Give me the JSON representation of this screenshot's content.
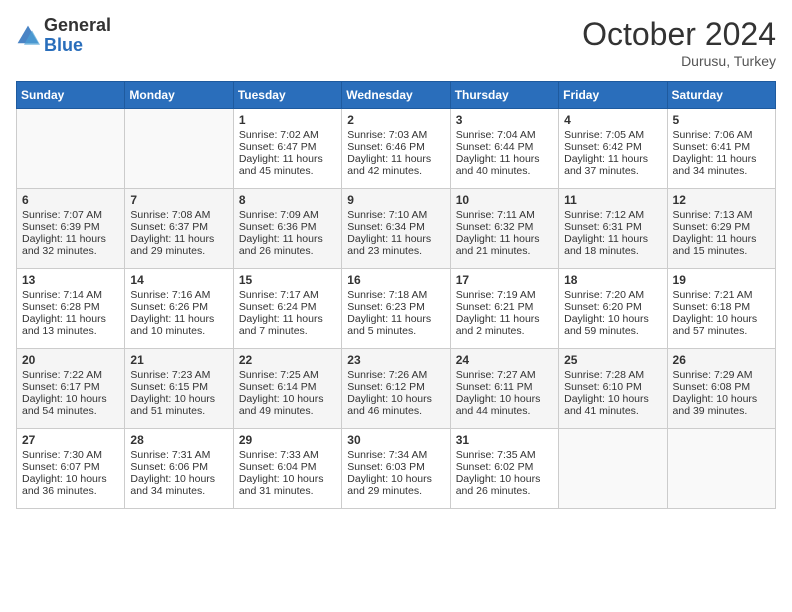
{
  "header": {
    "logo_general": "General",
    "logo_blue": "Blue",
    "month_title": "October 2024",
    "location": "Durusu, Turkey"
  },
  "days_of_week": [
    "Sunday",
    "Monday",
    "Tuesday",
    "Wednesday",
    "Thursday",
    "Friday",
    "Saturday"
  ],
  "weeks": [
    [
      {
        "day": "",
        "sunrise": "",
        "sunset": "",
        "daylight": ""
      },
      {
        "day": "",
        "sunrise": "",
        "sunset": "",
        "daylight": ""
      },
      {
        "day": "1",
        "sunrise": "Sunrise: 7:02 AM",
        "sunset": "Sunset: 6:47 PM",
        "daylight": "Daylight: 11 hours and 45 minutes."
      },
      {
        "day": "2",
        "sunrise": "Sunrise: 7:03 AM",
        "sunset": "Sunset: 6:46 PM",
        "daylight": "Daylight: 11 hours and 42 minutes."
      },
      {
        "day": "3",
        "sunrise": "Sunrise: 7:04 AM",
        "sunset": "Sunset: 6:44 PM",
        "daylight": "Daylight: 11 hours and 40 minutes."
      },
      {
        "day": "4",
        "sunrise": "Sunrise: 7:05 AM",
        "sunset": "Sunset: 6:42 PM",
        "daylight": "Daylight: 11 hours and 37 minutes."
      },
      {
        "day": "5",
        "sunrise": "Sunrise: 7:06 AM",
        "sunset": "Sunset: 6:41 PM",
        "daylight": "Daylight: 11 hours and 34 minutes."
      }
    ],
    [
      {
        "day": "6",
        "sunrise": "Sunrise: 7:07 AM",
        "sunset": "Sunset: 6:39 PM",
        "daylight": "Daylight: 11 hours and 32 minutes."
      },
      {
        "day": "7",
        "sunrise": "Sunrise: 7:08 AM",
        "sunset": "Sunset: 6:37 PM",
        "daylight": "Daylight: 11 hours and 29 minutes."
      },
      {
        "day": "8",
        "sunrise": "Sunrise: 7:09 AM",
        "sunset": "Sunset: 6:36 PM",
        "daylight": "Daylight: 11 hours and 26 minutes."
      },
      {
        "day": "9",
        "sunrise": "Sunrise: 7:10 AM",
        "sunset": "Sunset: 6:34 PM",
        "daylight": "Daylight: 11 hours and 23 minutes."
      },
      {
        "day": "10",
        "sunrise": "Sunrise: 7:11 AM",
        "sunset": "Sunset: 6:32 PM",
        "daylight": "Daylight: 11 hours and 21 minutes."
      },
      {
        "day": "11",
        "sunrise": "Sunrise: 7:12 AM",
        "sunset": "Sunset: 6:31 PM",
        "daylight": "Daylight: 11 hours and 18 minutes."
      },
      {
        "day": "12",
        "sunrise": "Sunrise: 7:13 AM",
        "sunset": "Sunset: 6:29 PM",
        "daylight": "Daylight: 11 hours and 15 minutes."
      }
    ],
    [
      {
        "day": "13",
        "sunrise": "Sunrise: 7:14 AM",
        "sunset": "Sunset: 6:28 PM",
        "daylight": "Daylight: 11 hours and 13 minutes."
      },
      {
        "day": "14",
        "sunrise": "Sunrise: 7:16 AM",
        "sunset": "Sunset: 6:26 PM",
        "daylight": "Daylight: 11 hours and 10 minutes."
      },
      {
        "day": "15",
        "sunrise": "Sunrise: 7:17 AM",
        "sunset": "Sunset: 6:24 PM",
        "daylight": "Daylight: 11 hours and 7 minutes."
      },
      {
        "day": "16",
        "sunrise": "Sunrise: 7:18 AM",
        "sunset": "Sunset: 6:23 PM",
        "daylight": "Daylight: 11 hours and 5 minutes."
      },
      {
        "day": "17",
        "sunrise": "Sunrise: 7:19 AM",
        "sunset": "Sunset: 6:21 PM",
        "daylight": "Daylight: 11 hours and 2 minutes."
      },
      {
        "day": "18",
        "sunrise": "Sunrise: 7:20 AM",
        "sunset": "Sunset: 6:20 PM",
        "daylight": "Daylight: 10 hours and 59 minutes."
      },
      {
        "day": "19",
        "sunrise": "Sunrise: 7:21 AM",
        "sunset": "Sunset: 6:18 PM",
        "daylight": "Daylight: 10 hours and 57 minutes."
      }
    ],
    [
      {
        "day": "20",
        "sunrise": "Sunrise: 7:22 AM",
        "sunset": "Sunset: 6:17 PM",
        "daylight": "Daylight: 10 hours and 54 minutes."
      },
      {
        "day": "21",
        "sunrise": "Sunrise: 7:23 AM",
        "sunset": "Sunset: 6:15 PM",
        "daylight": "Daylight: 10 hours and 51 minutes."
      },
      {
        "day": "22",
        "sunrise": "Sunrise: 7:25 AM",
        "sunset": "Sunset: 6:14 PM",
        "daylight": "Daylight: 10 hours and 49 minutes."
      },
      {
        "day": "23",
        "sunrise": "Sunrise: 7:26 AM",
        "sunset": "Sunset: 6:12 PM",
        "daylight": "Daylight: 10 hours and 46 minutes."
      },
      {
        "day": "24",
        "sunrise": "Sunrise: 7:27 AM",
        "sunset": "Sunset: 6:11 PM",
        "daylight": "Daylight: 10 hours and 44 minutes."
      },
      {
        "day": "25",
        "sunrise": "Sunrise: 7:28 AM",
        "sunset": "Sunset: 6:10 PM",
        "daylight": "Daylight: 10 hours and 41 minutes."
      },
      {
        "day": "26",
        "sunrise": "Sunrise: 7:29 AM",
        "sunset": "Sunset: 6:08 PM",
        "daylight": "Daylight: 10 hours and 39 minutes."
      }
    ],
    [
      {
        "day": "27",
        "sunrise": "Sunrise: 7:30 AM",
        "sunset": "Sunset: 6:07 PM",
        "daylight": "Daylight: 10 hours and 36 minutes."
      },
      {
        "day": "28",
        "sunrise": "Sunrise: 7:31 AM",
        "sunset": "Sunset: 6:06 PM",
        "daylight": "Daylight: 10 hours and 34 minutes."
      },
      {
        "day": "29",
        "sunrise": "Sunrise: 7:33 AM",
        "sunset": "Sunset: 6:04 PM",
        "daylight": "Daylight: 10 hours and 31 minutes."
      },
      {
        "day": "30",
        "sunrise": "Sunrise: 7:34 AM",
        "sunset": "Sunset: 6:03 PM",
        "daylight": "Daylight: 10 hours and 29 minutes."
      },
      {
        "day": "31",
        "sunrise": "Sunrise: 7:35 AM",
        "sunset": "Sunset: 6:02 PM",
        "daylight": "Daylight: 10 hours and 26 minutes."
      },
      {
        "day": "",
        "sunrise": "",
        "sunset": "",
        "daylight": ""
      },
      {
        "day": "",
        "sunrise": "",
        "sunset": "",
        "daylight": ""
      }
    ]
  ]
}
